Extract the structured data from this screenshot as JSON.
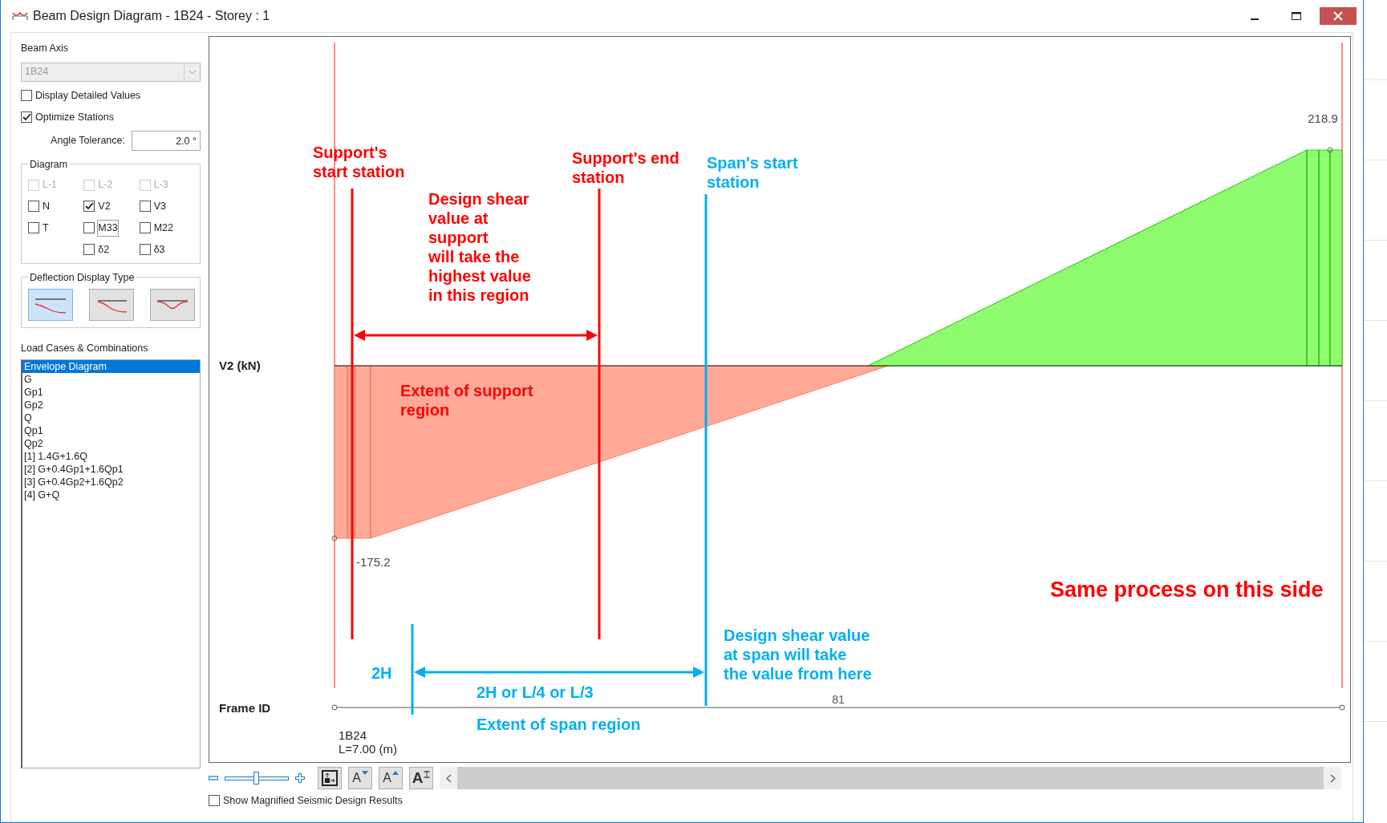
{
  "window": {
    "title": "Beam Design Diagram - 1B24 - Storey : 1"
  },
  "beam_axis": {
    "label": "Beam Axis",
    "value": "1B24",
    "disabled": true
  },
  "options": [
    {
      "label": "Display Detailed Values",
      "checked": false
    },
    {
      "label": "Optimize Stations",
      "checked": true
    }
  ],
  "angle_tolerance": {
    "label": "Angle Tolerance:",
    "value": "2.0 °"
  },
  "diagram": {
    "title": "Diagram",
    "items": [
      {
        "label": "L-1",
        "checked": false,
        "disabled": true,
        "focused": false
      },
      {
        "label": "L-2",
        "checked": false,
        "disabled": true,
        "focused": false
      },
      {
        "label": "L-3",
        "checked": false,
        "disabled": true,
        "focused": false
      },
      {
        "label": "N",
        "checked": false,
        "disabled": false,
        "focused": false
      },
      {
        "label": "V2",
        "checked": true,
        "disabled": false,
        "focused": false
      },
      {
        "label": "V3",
        "checked": false,
        "disabled": false,
        "focused": false
      },
      {
        "label": "T",
        "checked": false,
        "disabled": false,
        "focused": false
      },
      {
        "label": "M33",
        "checked": false,
        "disabled": false,
        "focused": true
      },
      {
        "label": "M22",
        "checked": false,
        "disabled": false,
        "focused": false
      },
      {
        "label": "δ2",
        "checked": false,
        "disabled": false,
        "focused": false
      },
      {
        "label": "δ3",
        "checked": false,
        "disabled": false,
        "focused": false
      }
    ]
  },
  "deflection_display": {
    "title": "Deflection Display Type",
    "options": [
      {
        "kind": "drop",
        "selected": true
      },
      {
        "kind": "shift",
        "selected": false
      },
      {
        "kind": "sag",
        "selected": false
      }
    ]
  },
  "load_cases": {
    "title": "Load Cases & Combinations",
    "items": [
      {
        "label": "Envelope Diagram",
        "selected": true
      },
      {
        "label": "G",
        "selected": false
      },
      {
        "label": "Gp1",
        "selected": false
      },
      {
        "label": "Gp2",
        "selected": false
      },
      {
        "label": "Q",
        "selected": false
      },
      {
        "label": "Qp1",
        "selected": false
      },
      {
        "label": "Qp2",
        "selected": false
      },
      {
        "label": "[1] 1.4G+1.6Q",
        "selected": false
      },
      {
        "label": "[2] G+0.4Gp1+1.6Qp1",
        "selected": false
      },
      {
        "label": "[3] G+0.4Gp2+1.6Qp2",
        "selected": false
      },
      {
        "label": "[4] G+Q",
        "selected": false
      }
    ]
  },
  "diagram_view": {
    "axis_label": "V2 (kN)",
    "frame_label": "Frame ID",
    "max_value": "218.9",
    "min_value": "-175.2",
    "frame_number": "81",
    "frame_name": "1B24",
    "frame_length": "L=7.00 (m)",
    "annotations": [
      {
        "text": "Support's\nstart station",
        "color": "#ff0000"
      },
      {
        "text": "Support's end\nstation",
        "color": "#ff0000"
      },
      {
        "text": "Span's start\nstation",
        "color": "#00b0f0"
      },
      {
        "text": "Design shear\nvalue at\nsupport\nwill take the\nhighest value\nin this region",
        "color": "#ff0000"
      },
      {
        "text": "Extent of support\nregion",
        "color": "#ff0000"
      },
      {
        "text": "Same process on this side",
        "color": "#ff0000"
      },
      {
        "text": "2H",
        "color": "#00b0f0"
      },
      {
        "text": "Design shear value\nat span will take\nthe value from here",
        "color": "#00b0f0"
      },
      {
        "text": "2H or L/4 or L/3",
        "color": "#00b0f0"
      },
      {
        "text": "Extent of span region",
        "color": "#00b0f0"
      }
    ]
  },
  "toolbar": {
    "zoom": {
      "level": 0.5
    },
    "buttons": [
      {
        "kind": "fit"
      },
      {
        "kind": "smaller",
        "glyph": "A"
      },
      {
        "kind": "larger",
        "glyph": "A"
      },
      {
        "kind": "resize",
        "glyph": "A"
      }
    ]
  },
  "bottom_option": {
    "label": "Show Magnified Seismic Design Results",
    "checked": false
  }
}
